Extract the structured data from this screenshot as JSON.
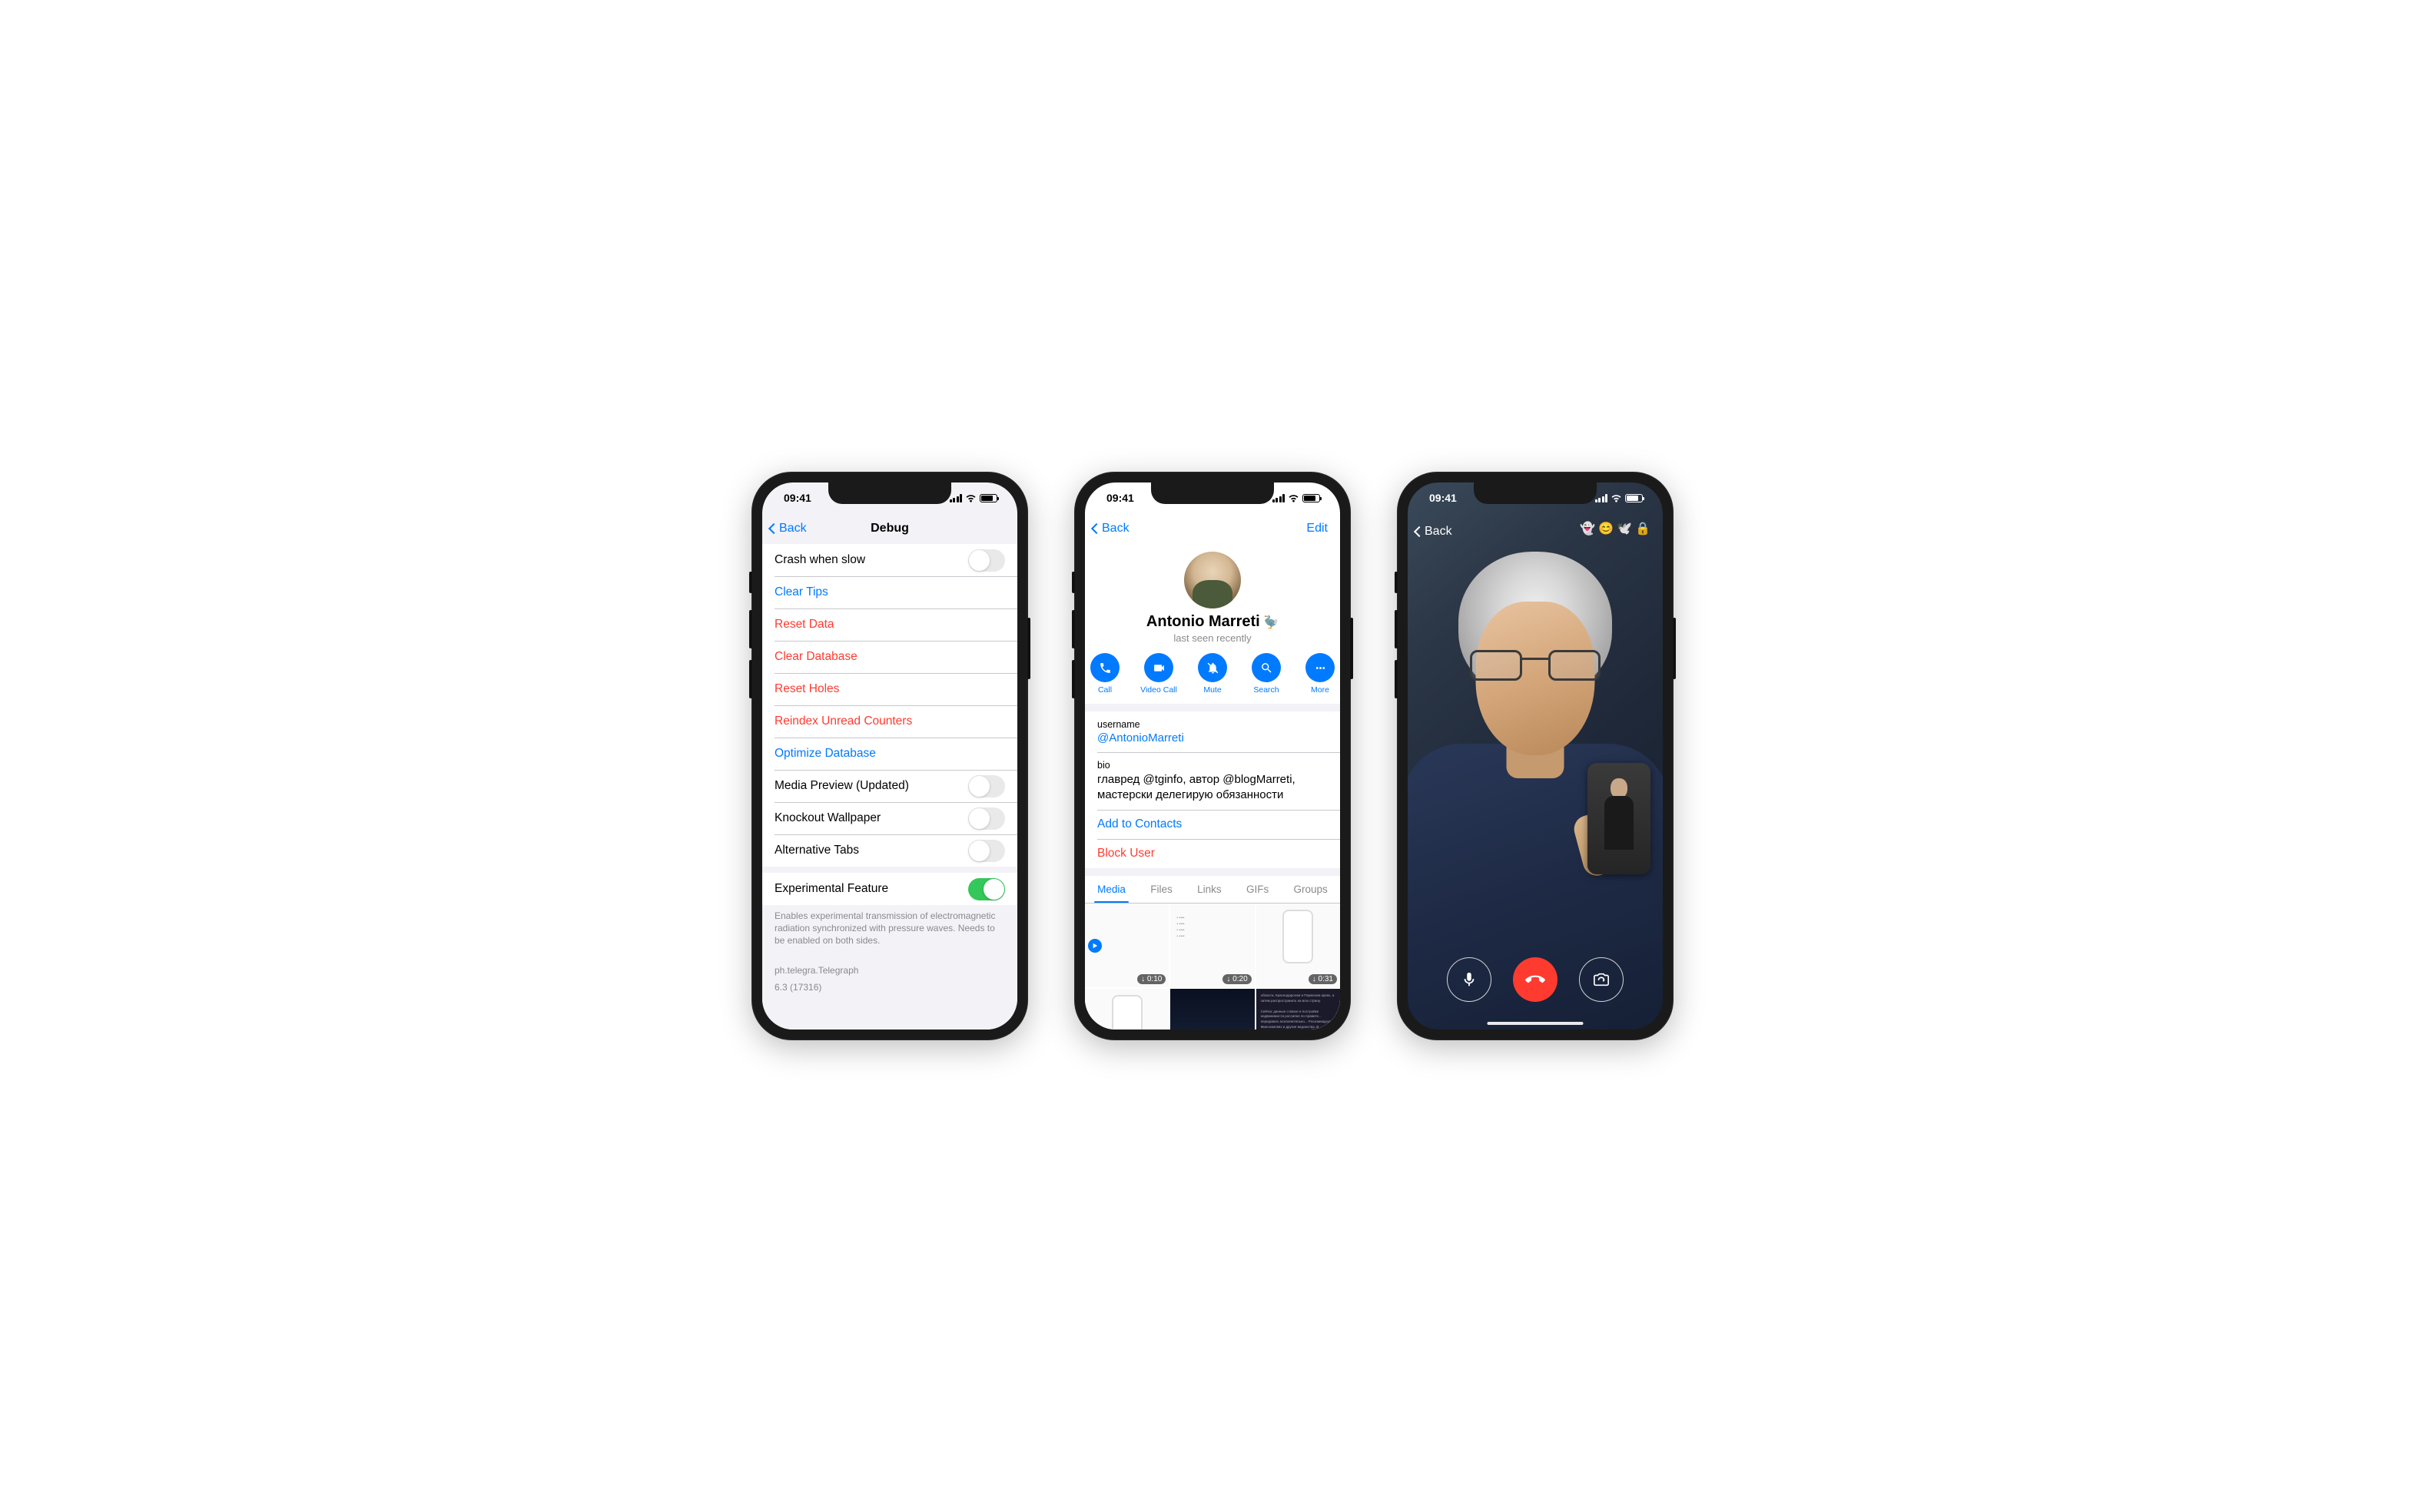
{
  "shared": {
    "time": "09:41"
  },
  "phone1": {
    "nav": {
      "back": "Back",
      "title": "Debug"
    },
    "rows": {
      "crash": "Crash when slow",
      "clearTips": "Clear Tips",
      "resetData": "Reset Data",
      "clearDb": "Clear Database",
      "resetHoles": "Reset Holes",
      "reindex": "Reindex Unread Counters",
      "optimize": "Optimize Database",
      "mediaPreview": "Media Preview (Updated)",
      "knockout": "Knockout Wallpaper",
      "altTabs": "Alternative Tabs",
      "experimental": "Experimental Feature"
    },
    "footer": {
      "desc": "Enables experimental transmission of electromagnetic radiation synchronized with pressure waves. Needs to be enabled on both sides.",
      "bundle": "ph.telegra.Telegraph",
      "version": "6.3 (17316)"
    }
  },
  "phone2": {
    "nav": {
      "back": "Back",
      "edit": "Edit"
    },
    "profile": {
      "name": "Antonio Marreti",
      "emoji": "🦤",
      "status": "last seen recently"
    },
    "actions": {
      "call": "Call",
      "video": "Video Call",
      "mute": "Mute",
      "search": "Search",
      "more": "More"
    },
    "info": {
      "usernameLabel": "username",
      "username": "@AntonioMarreti",
      "bioLabel": "bio",
      "bio": "главред @tginfo, автор @blogMarreti, мастерски делегирую обязанности",
      "addContact": "Add to Contacts",
      "block": "Block User"
    },
    "tabs": {
      "media": "Media",
      "files": "Files",
      "links": "Links",
      "gifs": "GIFs",
      "groups": "Groups"
    },
    "media": {
      "d1": "↓ 0:10",
      "d2": "↓ 0:20",
      "d3": "↓ 0:31"
    }
  },
  "phone3": {
    "nav": {
      "back": "Back"
    },
    "topIcons": {
      "i1": "👻",
      "i2": "😊",
      "i3": "🕊️",
      "i4": "🔒"
    }
  }
}
